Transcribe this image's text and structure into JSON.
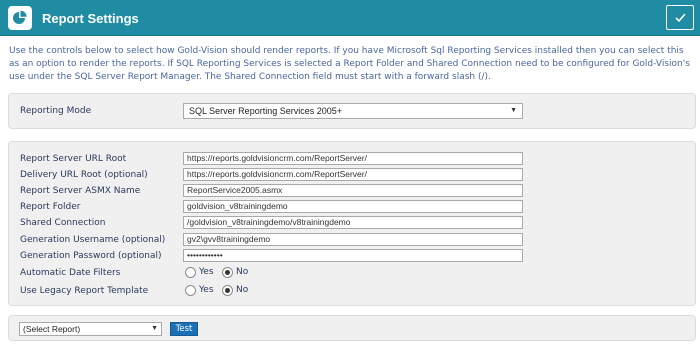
{
  "header": {
    "title": "Report Settings",
    "logo_icon": "pie-chart-icon",
    "confirm_icon": "checkmark-icon",
    "color": "#1f8ca3"
  },
  "intro": "Use the controls below to select how Gold-Vision should render reports. If you have Microsoft Sql Reporting Services installed then you can select this as an option to render the reports. If SQL Reporting Services is selected a Report Folder and Shared Connection need to be configured for Gold-Vision's use under the SQL Server Report Manager. The Shared Connection field must start with a forward slash (/).",
  "mode": {
    "label": "Reporting Mode",
    "selected": "SQL Server Reporting Services 2005+"
  },
  "fields": [
    {
      "label": "Report Server URL Root",
      "value": "https://reports.goldvisioncrm.com/ReportServer/"
    },
    {
      "label": "Delivery URL Root (optional)",
      "value": "https://reports.goldvisioncrm.com/ReportServer/"
    },
    {
      "label": "Report Server ASMX Name",
      "value": "ReportService2005.asmx"
    },
    {
      "label": "Report Folder",
      "value": "goldvision_v8trainingdemo"
    },
    {
      "label": "Shared Connection",
      "value": "/goldvision_v8trainingdemo/v8trainingdemo"
    },
    {
      "label": "Generation Username (optional)",
      "value": "gv2\\gvv8trainingdemo"
    },
    {
      "label": "Generation Password (optional)",
      "value": "••••••••••••"
    }
  ],
  "auto_date_filters": {
    "label": "Automatic Date Filters",
    "yes": "Yes",
    "no": "No",
    "selected": "No"
  },
  "legacy_template": {
    "label": "Use Legacy Report Template",
    "yes": "Yes",
    "no": "No",
    "selected": "No"
  },
  "test_section": {
    "select_value": "(Select Report)",
    "button": "Test"
  }
}
